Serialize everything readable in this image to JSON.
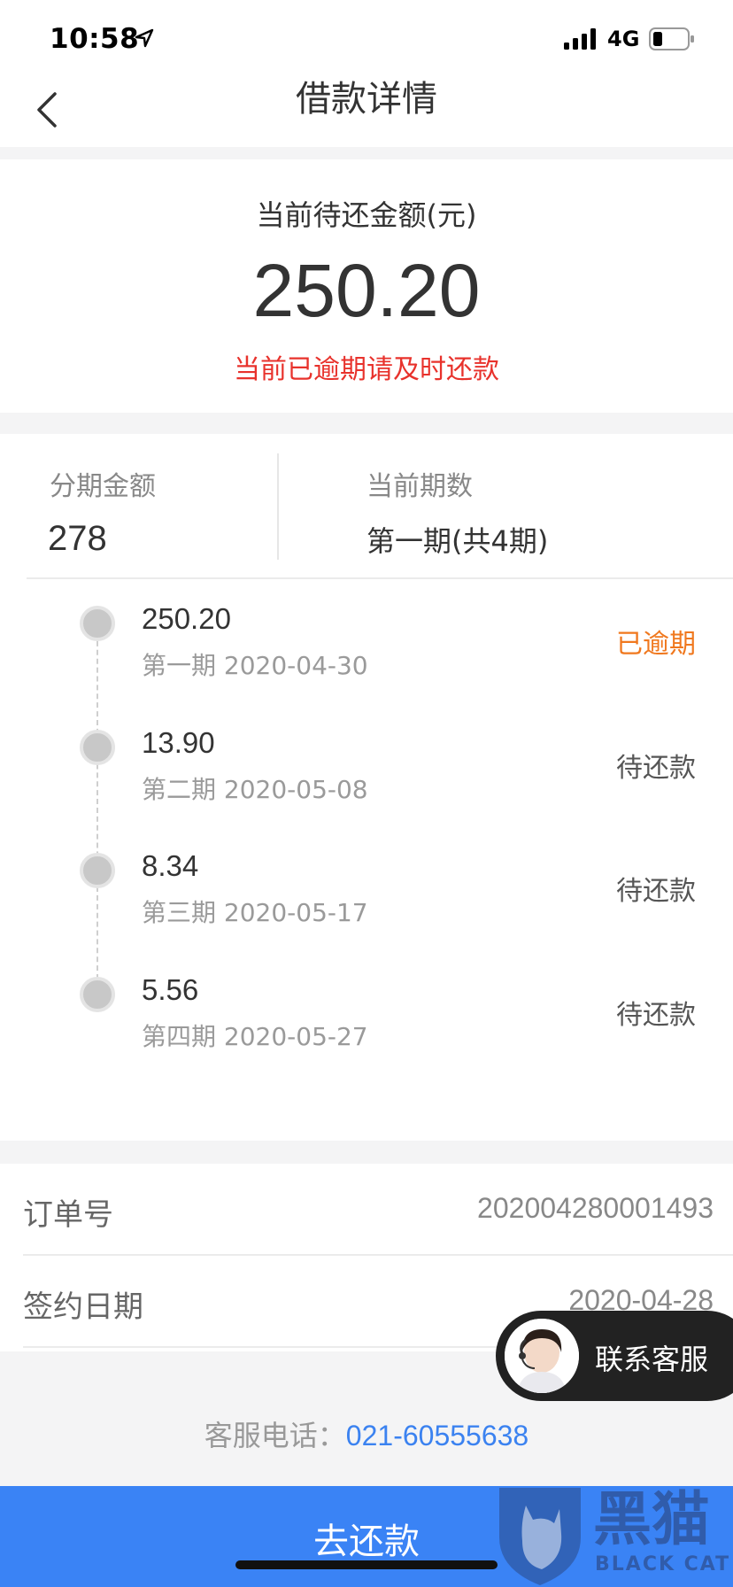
{
  "status_bar": {
    "time": "10:58",
    "network": "4G",
    "icons": [
      "location-arrow-icon",
      "signal-bars-icon",
      "battery-icon"
    ]
  },
  "nav": {
    "title": "借款详情",
    "back_icon": "chevron-left-icon"
  },
  "amount_card": {
    "label": "当前待还金额(元)",
    "value": "250.20",
    "notice": "当前已逾期请及时还款",
    "notice_color": "#e8322c"
  },
  "summary": {
    "installment_amount_label": "分期金额",
    "installment_amount_value": "278",
    "current_period_label": "当前期数",
    "current_period_value": "第一期(共4期)"
  },
  "installments": [
    {
      "amount": "250.20",
      "period": "第一期 2020-04-30",
      "status": "已逾期",
      "status_color": "#f0781e"
    },
    {
      "amount": "13.90",
      "period": "第二期 2020-05-08",
      "status": "待还款"
    },
    {
      "amount": "8.34",
      "period": "第三期 2020-05-17",
      "status": "待还款"
    },
    {
      "amount": "5.56",
      "period": "第四期 2020-05-27",
      "status": "待还款"
    }
  ],
  "order_info": {
    "order_no_label": "订单号",
    "order_no_value": "202004280001493",
    "sign_date_label": "签约日期",
    "sign_date_value": "2020-04-28"
  },
  "support": {
    "label": "联系客服",
    "avatar_icon": "customer-service-avatar-icon"
  },
  "hotline": {
    "label": "客服电话：",
    "number": "021-60555638",
    "number_color": "#3b82f0"
  },
  "repay_button": {
    "label": "去还款",
    "color": "#3a83f5"
  },
  "watermark": {
    "text": "黑猫",
    "sub": "BLACK CAT"
  }
}
